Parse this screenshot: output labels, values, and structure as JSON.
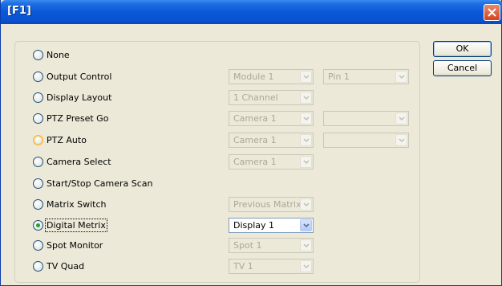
{
  "window": {
    "title": "[F1]"
  },
  "buttons": {
    "ok_label": "OK",
    "cancel_label": "Cancel"
  },
  "options": [
    {
      "label": "None"
    },
    {
      "label": "Output Control",
      "combo1": "Module 1",
      "combo2": "Pin 1"
    },
    {
      "label": "Display Layout",
      "combo1": "1 Channel"
    },
    {
      "label": "PTZ Preset Go",
      "combo1": "Camera 1",
      "combo2": ""
    },
    {
      "label": "PTZ Auto",
      "combo1": "Camera 1",
      "combo2": ""
    },
    {
      "label": "Camera Select",
      "combo1": "Camera 1"
    },
    {
      "label": "Start/Stop Camera Scan"
    },
    {
      "label": "Matrix Switch",
      "combo1": "Previous Matrix"
    },
    {
      "label": "Digital Metrix",
      "combo1": "Display 1",
      "selected": true
    },
    {
      "label": "Spot Monitor",
      "combo1": "Spot 1"
    },
    {
      "label": "TV Quad",
      "combo1": "TV 1"
    }
  ],
  "colors": {
    "titlebar": "#0a58d8",
    "close": "#d7421f",
    "radio_checked": "#22a039"
  }
}
